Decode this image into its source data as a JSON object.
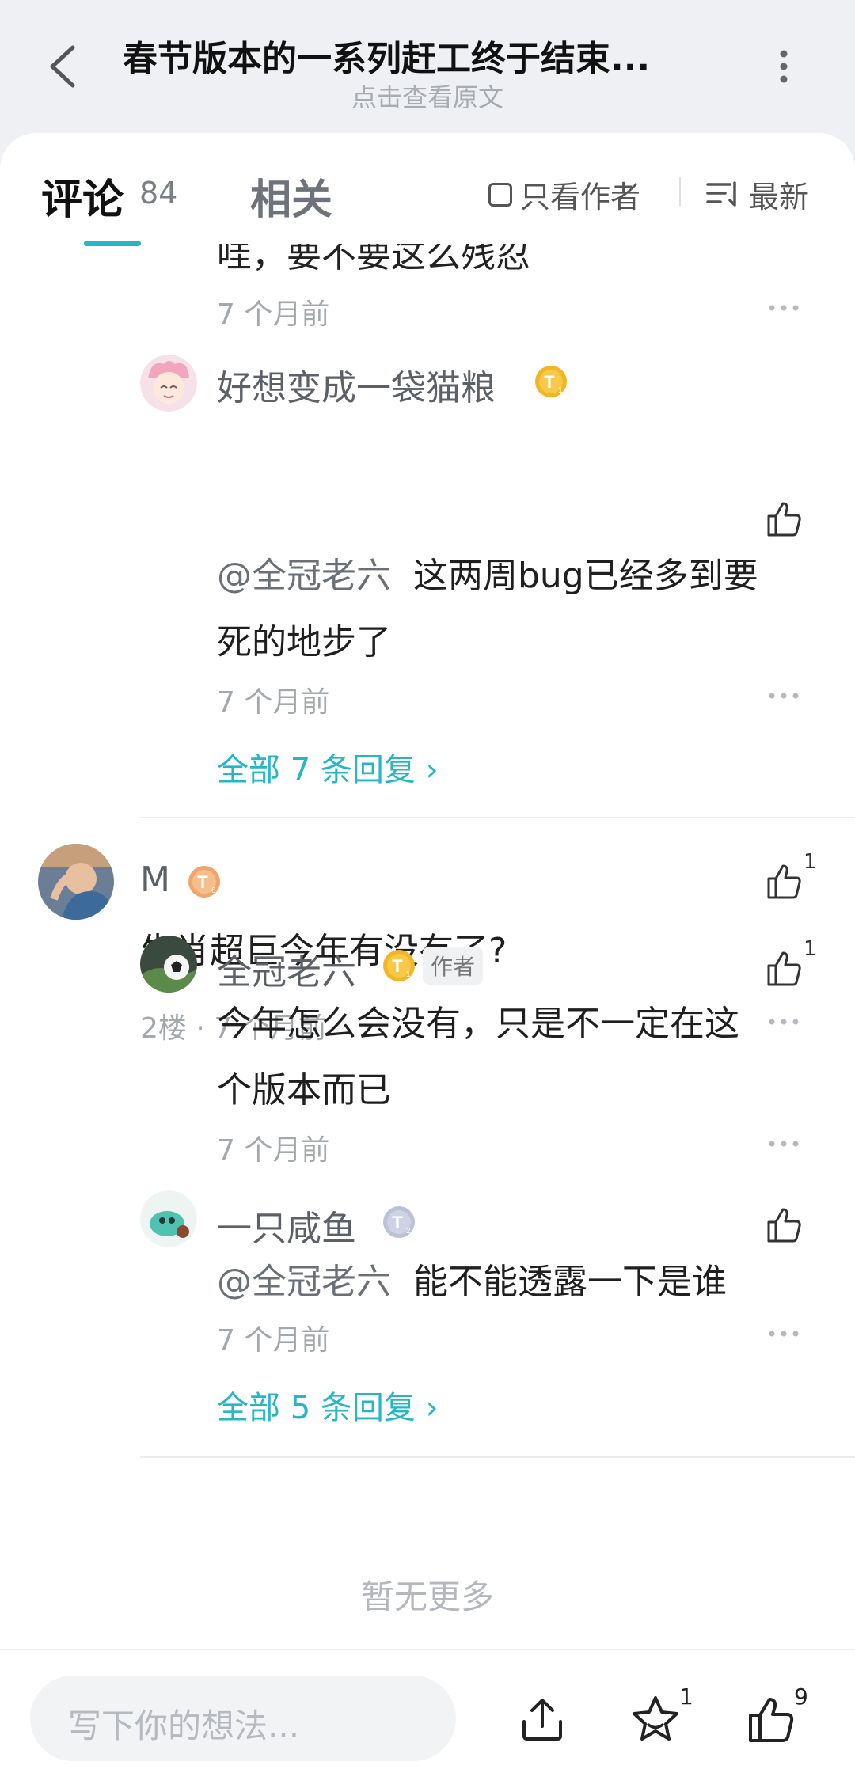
{
  "header": {
    "title": "春节版本的一系列赶工终于结束...",
    "subtitle": "点击查看原文"
  },
  "tabs": {
    "comments_label": "评论",
    "comments_count": "84",
    "related_label": "相关",
    "only_author_label": "只看作者",
    "sort_label": "最新"
  },
  "thread1": {
    "clipped_text": "哇，要不要这么残忍",
    "clipped_time": "7 个月前",
    "reply": {
      "username": "好想变成一袋猫粮",
      "badge": "T1",
      "mention": "@全冠老六",
      "text": "这两周bug已经多到要死的地步了",
      "line1": "这两周bug已经多到要",
      "line2": "死的地步了",
      "time": "7 个月前"
    },
    "all_replies": "全部 7 条回复 ›"
  },
  "comment2": {
    "username": "M",
    "badge": "T6",
    "likes": "1",
    "text": "生肖超巨今年有没有了?",
    "floor": "2楼",
    "time": "7 个月前",
    "replies": [
      {
        "username": "全冠老六",
        "badge": "T1",
        "author_tag": "作者",
        "likes": "1",
        "line1": "今年怎么会没有，只是不一定在这",
        "line2": "个版本而已",
        "time": "7 个月前"
      },
      {
        "username": "一只咸鱼",
        "badge": "T2",
        "mention": "@全冠老六",
        "text": "能不能透露一下是谁",
        "time": "7 个月前"
      }
    ],
    "all_replies": "全部 5 条回复 ›"
  },
  "no_more": "暂无更多",
  "bottom_bar": {
    "input_placeholder": "写下你的想法...",
    "favorite_count": "1",
    "like_count": "9"
  },
  "colors": {
    "accent": "#26b6c6",
    "badge_gold": "#f3b521",
    "badge_silver": "#b9c2d6",
    "badge_bronze": "#f0a66a"
  }
}
